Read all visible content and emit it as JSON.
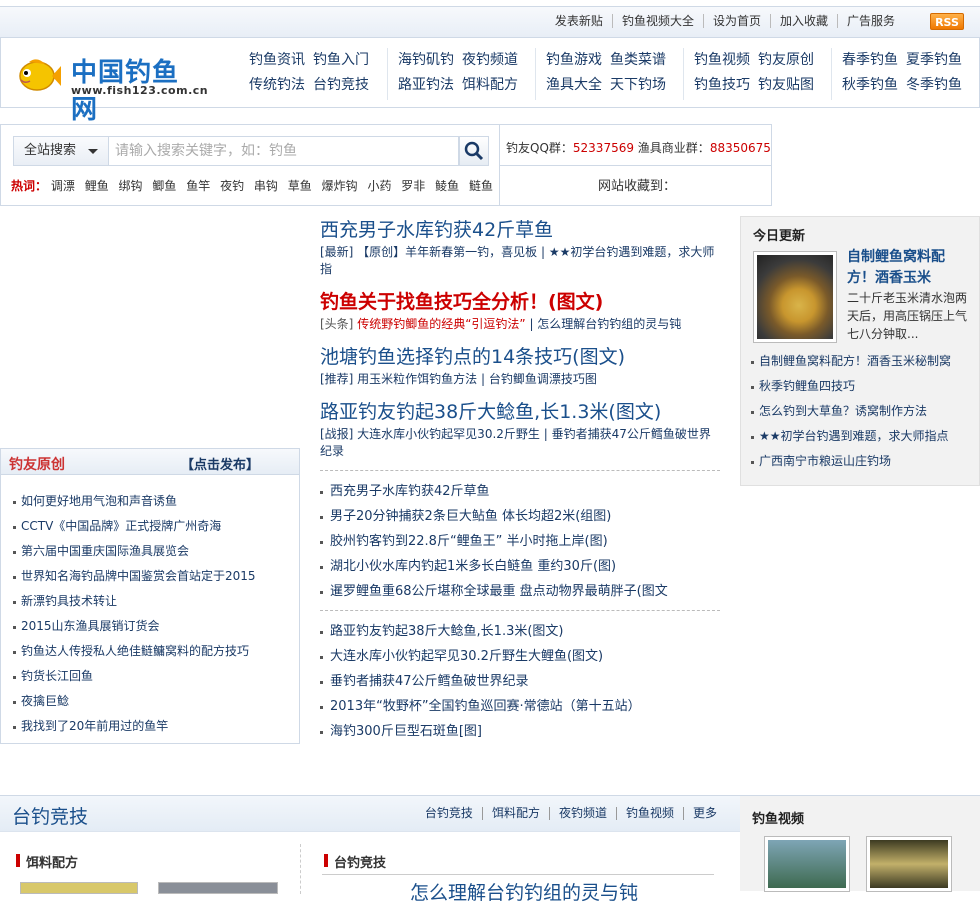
{
  "top_links": [
    "发表新贴",
    "钓鱼视频大全",
    "设为首页",
    "加入收藏",
    "广告服务"
  ],
  "rss_label": "RSS",
  "logo": {
    "title": "中国钓鱼网",
    "url": "www.fish123.com.cn"
  },
  "nav": [
    [
      [
        "钓鱼资讯",
        "钓鱼入门"
      ],
      [
        "传统钓法",
        "台钓竞技"
      ]
    ],
    [
      [
        "海钓矶钓",
        "夜钓频道"
      ],
      [
        "路亚钓法",
        "饵料配方"
      ]
    ],
    [
      [
        "钓鱼游戏",
        "鱼类菜谱"
      ],
      [
        "渔具大全",
        "天下钓场"
      ]
    ],
    [
      [
        "钓鱼视频",
        "钓友原创"
      ],
      [
        "钓鱼技巧",
        "钓友贴图"
      ]
    ],
    [
      [
        "春季钓鱼",
        "夏季钓鱼"
      ],
      [
        "秋季钓鱼",
        "冬季钓鱼"
      ]
    ]
  ],
  "search": {
    "scope": "全站搜索",
    "placeholder": "请输入搜索关键字，如：钓鱼"
  },
  "hot": {
    "label": "热词：",
    "words": [
      "调漂",
      "鲤鱼",
      "绑钩",
      "鲫鱼",
      "鱼竿",
      "夜钓",
      "串钩",
      "草鱼",
      "爆炸钩",
      "小药",
      "罗非",
      "鲮鱼",
      "鲢鱼"
    ]
  },
  "qq": {
    "label1": "钓友QQ群：",
    "num1": "52337569",
    "label2": " 渔具商业群：",
    "num2": "88350675",
    "collect": "网站收藏到："
  },
  "yuanchuang": {
    "title": "钓友原创",
    "publish": "【点击发布】",
    "items": [
      "如何更好地用气泡和声音诱鱼",
      "CCTV《中国品牌》正式授牌广州奇海",
      "第六届中国重庆国际渔具展览会",
      "世界知名海钓品牌中国鉴赏会首站定于2015",
      "新漂钓具技术转让",
      "2015山东渔具展销订货会",
      "钓鱼达人传授私人绝佳鲢鳙窝料的配方技巧",
      "钓货长江回鱼",
      "夜擒巨鲶",
      "我找到了20年前用过的鱼竿"
    ]
  },
  "headlines": [
    {
      "title": "西充男子水库钓获42斤草鱼",
      "sub": "[最新] 【原创】羊年新春第一钓，喜见板 | ★★初学台钓遇到难题，求大师指",
      "red": false
    },
    {
      "title": "钓鱼关于找鱼技巧全分析！(图文)",
      "sub_tag": "[头条]",
      "sub_red": " 传统野钓鲫鱼的经典“引逗钓法” ",
      "sub_rest": "| 怎么理解台钓钓组的灵与钝",
      "red": true
    },
    {
      "title": "池塘钓鱼选择钓点的14条技巧(图文)",
      "sub": "[推荐] 用玉米粒作饵钓鱼方法 | 台钓鲫鱼调漂技巧图",
      "red": false
    },
    {
      "title": "路亚钓友钓起38斤大鲶鱼,长1.3米(图文)",
      "sub": "[战报] 大连水库小伙钓起罕见30.2斤野生 | 垂钓者捕获47公斤鳕鱼破世界纪录",
      "red": false
    }
  ],
  "list1": [
    "西充男子水库钓获42斤草鱼",
    "男子20分钟捕获2条巨大鲇鱼 体长均超2米(组图)",
    "胶州钓客钓到22.8斤“鲤鱼王” 半小时拖上岸(图)",
    "湖北小伙水库内钓起1米多长白鲢鱼 重约30斤(图)",
    "暹罗鲤鱼重68公斤堪称全球最重 盘点动物界最萌胖子(图文"
  ],
  "list2": [
    "路亚钓友钓起38斤大鲶鱼,长1.3米(图文)",
    "大连水库小伙钓起罕见30.2斤野生大鲤鱼(图文)",
    "垂钓者捕获47公斤鳕鱼破世界纪录",
    "2013年“牧野杯”全国钓鱼巡回赛·常德站（第十五站）",
    "海钓300斤巨型石斑鱼[图]"
  ],
  "today": {
    "title": "今日更新",
    "feature_title": "自制鲤鱼窝料配方！酒香玉米",
    "feature_desc": "二十斤老玉米清水泡两天后，用高压锅压上气七八分钟取...",
    "items": [
      "自制鲤鱼窝料配方！酒香玉米秘制窝",
      "秋季钓鲤鱼四技巧",
      "怎么钓到大草鱼？诱窝制作方法",
      "★★初学台钓遇到难题，求大师指点",
      "广西南宁市粮运山庄钓场"
    ]
  },
  "taidiao": {
    "title": "台钓竞技",
    "links": [
      "台钓竞技",
      "饵料配方",
      "夜钓频道",
      "钓鱼视频",
      "更多"
    ],
    "sec1": "饵料配方",
    "sec2": "台钓竞技",
    "bottom_text": "怎么理解台钓钓组的灵与钝"
  },
  "video": {
    "title": "钓鱼视频"
  }
}
